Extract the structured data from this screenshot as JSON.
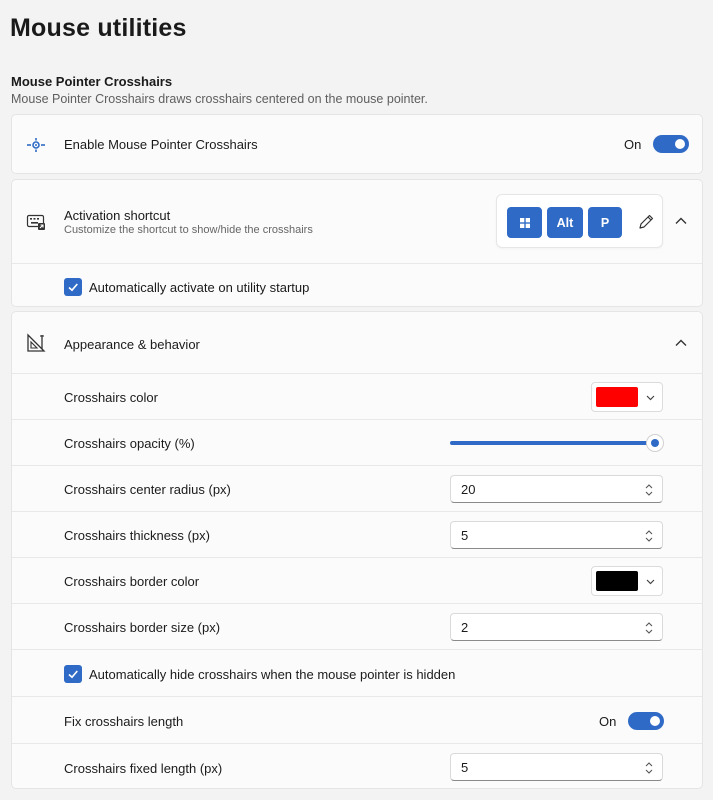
{
  "page": {
    "title": "Mouse utilities"
  },
  "section": {
    "title": "Mouse Pointer Crosshairs",
    "description": "Mouse Pointer Crosshairs draws crosshairs centered on the mouse pointer."
  },
  "enable": {
    "label": "Enable Mouse Pointer Crosshairs",
    "state_text": "On",
    "on": true
  },
  "shortcut": {
    "label": "Activation shortcut",
    "description": "Customize the shortcut to show/hide the crosshairs",
    "keys": [
      "",
      "Alt",
      "P"
    ],
    "key_icons": [
      "windows-key-icon",
      "",
      ""
    ],
    "auto_activate_label": "Automatically activate on utility startup",
    "auto_activate_checked": true
  },
  "appearance": {
    "label": "Appearance & behavior",
    "color": {
      "label": "Crosshairs color",
      "value": "#ff0000"
    },
    "opacity": {
      "label": "Crosshairs opacity (%)",
      "value": 100
    },
    "center_radius": {
      "label": "Crosshairs center radius (px)",
      "value": "20"
    },
    "thickness": {
      "label": "Crosshairs thickness (px)",
      "value": "5"
    },
    "border_color": {
      "label": "Crosshairs border color",
      "value": "#000000"
    },
    "border_size": {
      "label": "Crosshairs border size (px)",
      "value": "2"
    },
    "auto_hide": {
      "label": "Automatically hide crosshairs when the mouse pointer is hidden",
      "checked": true
    },
    "fix_length": {
      "label": "Fix crosshairs length",
      "state_text": "On",
      "on": true
    },
    "fixed_length": {
      "label": "Crosshairs fixed length (px)",
      "value": "5"
    }
  },
  "colors": {
    "accent": "#2f6bc6",
    "background": "#f3f3f3",
    "card": "#fbfbfb"
  }
}
